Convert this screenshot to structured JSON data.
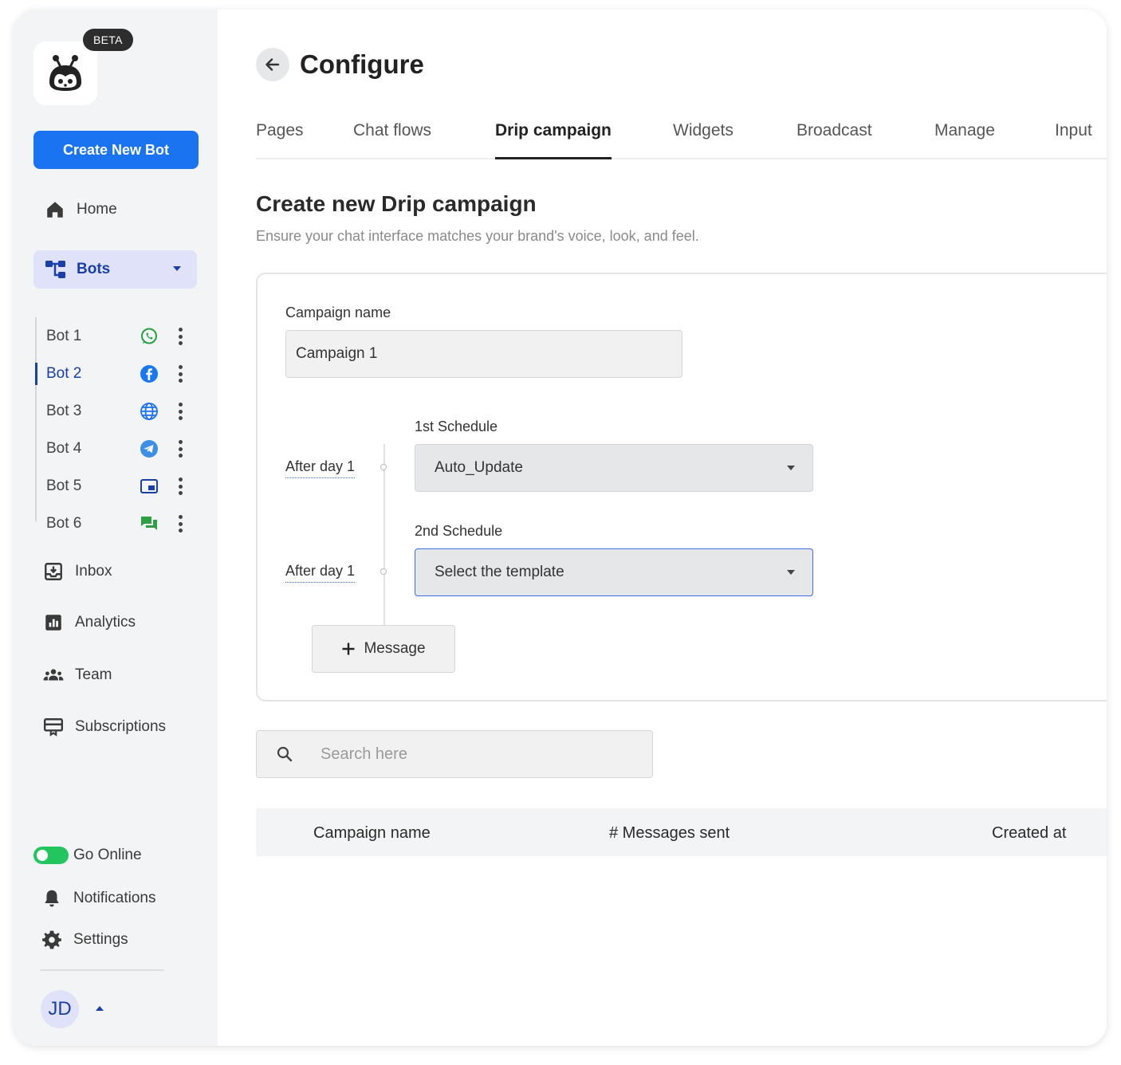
{
  "sidebar": {
    "beta_badge": "BETA",
    "create_button": "Create New Bot",
    "home": "Home",
    "bots": "Bots",
    "bot_list": [
      {
        "name": "Bot 1",
        "channel": "whatsapp-icon",
        "color": "#25a244"
      },
      {
        "name": "Bot 2",
        "channel": "facebook-icon",
        "color": "#1877f2"
      },
      {
        "name": "Bot 3",
        "channel": "globe-icon",
        "color": "#1a73f0"
      },
      {
        "name": "Bot 4",
        "channel": "telegram-icon",
        "color": "#3d8ee6"
      },
      {
        "name": "Bot 5",
        "channel": "widget-icon",
        "color": "#1b3fa8"
      },
      {
        "name": "Bot 6",
        "channel": "chat-icon",
        "color": "#2ea043"
      }
    ],
    "inbox": "Inbox",
    "analytics": "Analytics",
    "team": "Team",
    "subscriptions": "Subscriptions",
    "go_online": "Go Online",
    "notifications": "Notifications",
    "settings": "Settings",
    "avatar_initials": "JD"
  },
  "header": {
    "title": "Configure",
    "tabs": [
      "Pages",
      "Chat flows",
      "Drip campaign",
      "Widgets",
      "Broadcast",
      "Manage",
      "Input"
    ],
    "active_tab": "Drip campaign"
  },
  "drip": {
    "title": "Create new Drip campaign",
    "subtitle": "Ensure your chat interface matches your brand's voice, look, and feel.",
    "campaign_name_label": "Campaign name",
    "campaign_name_value": "Campaign 1",
    "schedules": [
      {
        "label": "1st Schedule",
        "after": "After day 1",
        "value": "Auto_Update"
      },
      {
        "label": "2nd Schedule",
        "after": "After day 1",
        "value": "Select the template"
      }
    ],
    "add_message": "Message"
  },
  "search": {
    "placeholder": "Search here"
  },
  "table": {
    "headers": [
      "Campaign name",
      "# Messages sent",
      "Created at"
    ]
  },
  "colors": {
    "accent": "#1a73f0",
    "active_nav": "#1b3fa8",
    "online": "#22c55e"
  }
}
